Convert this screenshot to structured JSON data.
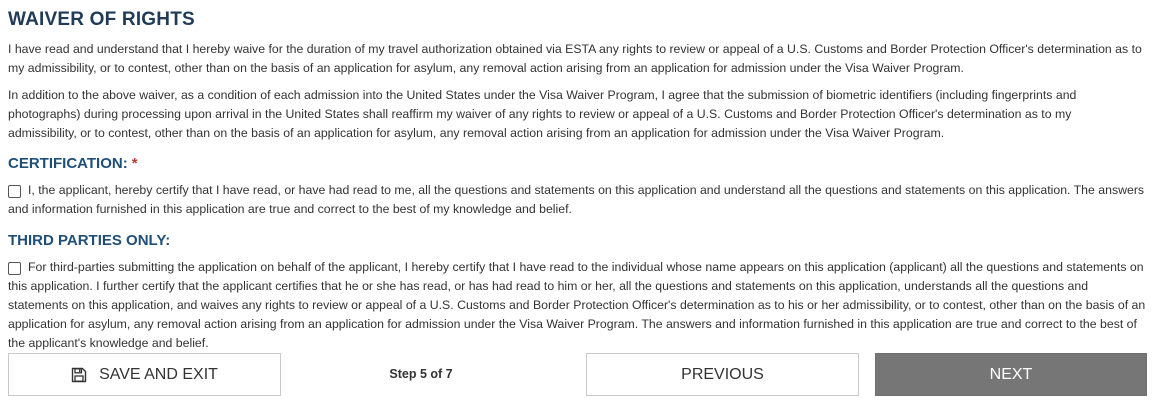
{
  "waiver": {
    "title": "WAIVER OF RIGHTS",
    "paragraph1": "I have read and understand that I hereby waive for the duration of my travel authorization obtained via ESTA any rights to review or appeal of a U.S. Customs and Border Protection Officer's determination as to my admissibility, or to contest, other than on the basis of an application for asylum, any removal action arising from an application for admission under the Visa Waiver Program.",
    "paragraph2": "In addition to the above waiver, as a condition of each admission into the United States under the Visa Waiver Program, I agree that the submission of biometric identifiers (including fingerprints and photographs) during processing upon arrival in the United States shall reaffirm my waiver of any rights to review or appeal of a U.S. Customs and Border Protection Officer's determination as to my admissibility, or to contest, other than on the basis of an application for asylum, any removal action arising from an application for admission under the Visa Waiver Program."
  },
  "certification": {
    "title": "CERTIFICATION:",
    "required_mark": "*",
    "checkbox_checked": false,
    "text": "I, the applicant, hereby certify that I have read, or have had read to me, all the questions and statements on this application and understand all the questions and statements on this application. The answers and information furnished in this application are true and correct to the best of my knowledge and belief."
  },
  "third_parties": {
    "title": "THIRD PARTIES ONLY:",
    "checkbox_checked": false,
    "text": "For third-parties submitting the application on behalf of the applicant, I hereby certify that I have read to the individual whose name appears on this application (applicant) all the questions and statements on this application. I further certify that the applicant certifies that he or she has read, or has had read to him or her, all the questions and statements on this application, understands all the questions and statements on this application, and waives any rights to review or appeal of a U.S. Customs and Border Protection Officer's determination as to his or her admissibility, or to contest, other than on the basis of an application for asylum, any removal action arising from an application for admission under the Visa Waiver Program. The answers and information furnished in this application are true and correct to the best of the applicant's knowledge and belief."
  },
  "footer": {
    "save_label": "SAVE AND EXIT",
    "save_icon": "save-icon",
    "step_text": "Step 5 of 7",
    "previous_label": "PREVIOUS",
    "next_label": "NEXT"
  },
  "colors": {
    "heading": "#1f3b57",
    "subheading": "#1f4f77",
    "required": "#c0392b",
    "next_button_bg": "#767676"
  }
}
